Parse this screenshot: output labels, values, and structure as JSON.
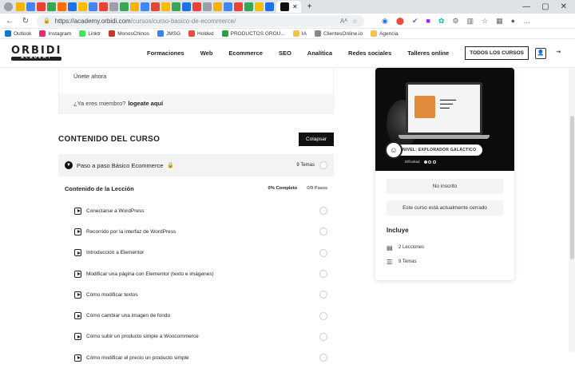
{
  "browser": {
    "tab_favicon_colors": [
      "#f4b400",
      "#4285f4",
      "#ea4335",
      "#34a853",
      "#ff6d00",
      "#1a73e8",
      "#fbbc05",
      "#4285f4",
      "#ea4335",
      "#9aa0a6",
      "#34a853",
      "#f4b400",
      "#4285f4",
      "#ea4335",
      "#fbbc05",
      "#34a853",
      "#1a73e8",
      "#ea4335",
      "#9aa0a6",
      "#f4b400",
      "#4285f4",
      "#ea4335",
      "#34a853",
      "#fbbc05",
      "#1a73e8"
    ],
    "url_host": "https://academy.orbidi.com",
    "url_path": "/cursos/curso-basico-de-ecommerce/",
    "bookmarks": [
      {
        "label": "Outlook",
        "color": "#0078d4"
      },
      {
        "label": "Instagram",
        "color": "#e1306c"
      },
      {
        "label": "Linktr",
        "color": "#43e55e"
      },
      {
        "label": "MonosChinos",
        "color": "#c0392b"
      },
      {
        "label": "JMSG",
        "color": "#3b82f6"
      },
      {
        "label": "Holded",
        "color": "#e74c3c"
      },
      {
        "label": "PRODUCTOS GROU...",
        "color": "#2e9e44"
      },
      {
        "label": "IA",
        "color": "#f2c14e"
      },
      {
        "label": "ClientesOnline.io",
        "color": "#888888"
      },
      {
        "label": "Agencia",
        "color": "#f2c14e"
      }
    ]
  },
  "header": {
    "logo_text": "ORBIDI",
    "logo_sub": "ACADEMY",
    "menu": [
      "Formaciones",
      "Web",
      "Ecommerce",
      "SEO",
      "Analítica",
      "Redes sociales",
      "Talleres online"
    ],
    "all_courses": "TODOS LOS CURSOS"
  },
  "join": {
    "join_label": "Únete ahora",
    "member_q": "¿Ya eres miembro?",
    "login_link": "logeate aquí"
  },
  "content": {
    "title": "CONTENIDO DEL CURSO",
    "collapse": "Colapsar",
    "topic_title": "Paso a paso Básico Ecommerce",
    "topic_count": "9 Temas",
    "lesson_header": "Contenido de la Lección",
    "completion": "0% Completo",
    "steps": "0/9 Pasos",
    "lessons": [
      "Conectarse a WordPress",
      "Recorrido por la interfaz de WordPress",
      "Introducción a Elementor",
      "Modificar una página con Elementor (texto e imágenes)",
      "Cómo modificar textos",
      "Cómo cambiar una imagen de fondo",
      "Cómo subir un producto simple a Woocommerce",
      "Cómo modificar el precio un producto simple"
    ]
  },
  "card": {
    "level_badge": "NIVEL: EXPLORADOR GALÁCTICO",
    "difficulty_label": "Dificultad",
    "difficulty_level": 1,
    "difficulty_max": 3,
    "status": "No inscrito",
    "closed": "Este curso está actualmente cerrado",
    "includes_title": "Incluye",
    "includes": [
      "2 Lecciones",
      "9 Temas"
    ]
  }
}
